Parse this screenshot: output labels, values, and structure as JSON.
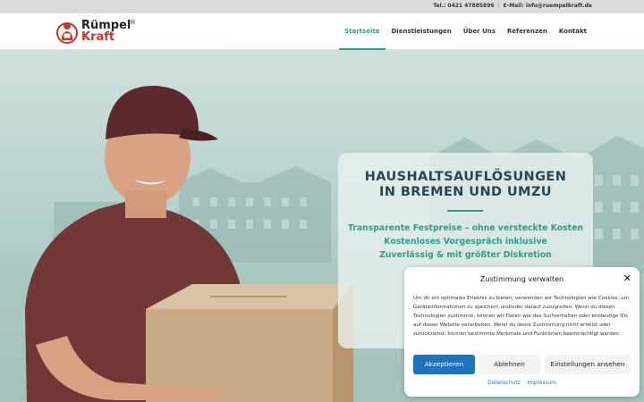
{
  "topbar": {
    "phone": "Tel.: 0421 47885896",
    "separator": "|",
    "email": "E-Mail: info@ruempelkraft.de"
  },
  "logo": {
    "line1": "Rümpel",
    "line2": "Kraft",
    "registered": "®"
  },
  "nav": {
    "items": [
      {
        "label": "Startseite",
        "active": true
      },
      {
        "label": "Dienstleistungen",
        "active": false
      },
      {
        "label": "Über Uns",
        "active": false
      },
      {
        "label": "Referenzen",
        "active": false
      },
      {
        "label": "Kontakt",
        "active": false
      }
    ]
  },
  "hero": {
    "title_line1": "HAUSHALTSAUFLÖSUNGEN",
    "title_line2": "IN BREMEN UND UMZU",
    "points": [
      "Transparente Festpreise – ohne versteckte Kosten",
      "Kostenloses Vorgespräch inklusive",
      "Zuverlässig & mit größter Diskretion"
    ]
  },
  "consent": {
    "title": "Zustimmung verwalten",
    "close": "✕",
    "body": "Um dir ein optimales Erlebnis zu bieten, verwenden wir Technologien wie Cookies, um Geräteinformationen zu speichern und/oder darauf zuzugreifen. Wenn du diesen Technologien zustimmst, können wir Daten wie das Surfverhalten oder eindeutige IDs auf dieser Website verarbeiten. Wenn du deine Zustimmung nicht erteilst oder zurückziehst, können bestimmte Merkmale und Funktionen beeinträchtigt werden.",
    "accept": "Akzeptieren",
    "deny": "Ablehnen",
    "settings": "Einstellungen ansehen",
    "link_privacy": "Datenschutz",
    "link_imprint": "Impressum"
  },
  "colors": {
    "accent": "#2e9e8a",
    "title": "#2a4652",
    "brand_red": "#c0392b",
    "button_blue": "#1e73be"
  }
}
